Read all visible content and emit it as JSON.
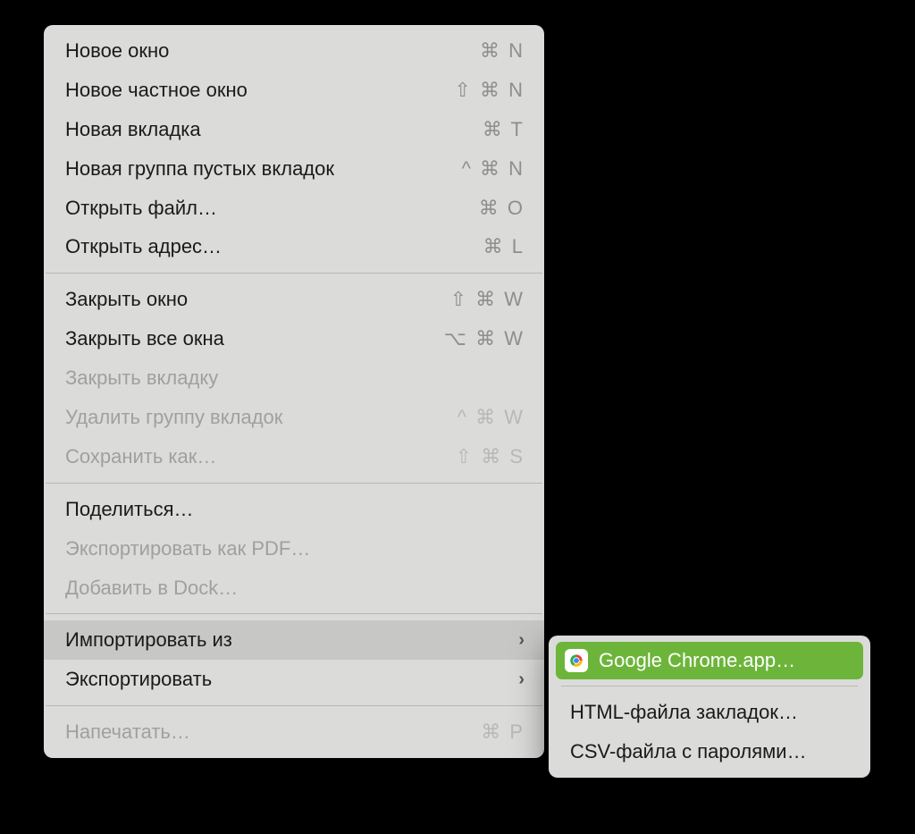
{
  "main_menu": {
    "items": [
      {
        "label": "Новое окно",
        "shortcut": "⌘ N",
        "disabled": false
      },
      {
        "label": "Новое частное окно",
        "shortcut": "⇧ ⌘ N",
        "disabled": false
      },
      {
        "label": "Новая вкладка",
        "shortcut": "⌘ T",
        "disabled": false
      },
      {
        "label": "Новая группа пустых вкладок",
        "shortcut": "^ ⌘ N",
        "disabled": false
      },
      {
        "label": "Открыть файл…",
        "shortcut": "⌘ O",
        "disabled": false
      },
      {
        "label": "Открыть адрес…",
        "shortcut": "⌘ L",
        "disabled": false
      },
      {
        "separator": true
      },
      {
        "label": "Закрыть окно",
        "shortcut": "⇧ ⌘ W",
        "disabled": false
      },
      {
        "label": "Закрыть все окна",
        "shortcut": "⌥ ⌘ W",
        "disabled": false
      },
      {
        "label": "Закрыть вкладку",
        "shortcut": "",
        "disabled": true
      },
      {
        "label": "Удалить группу вкладок",
        "shortcut": "^ ⌘ W",
        "disabled": true
      },
      {
        "label": "Сохранить как…",
        "shortcut": "⇧ ⌘ S",
        "disabled": true
      },
      {
        "separator": true
      },
      {
        "label": "Поделиться…",
        "shortcut": "",
        "disabled": false
      },
      {
        "label": "Экспортировать как PDF…",
        "shortcut": "",
        "disabled": true
      },
      {
        "label": "Добавить в Dock…",
        "shortcut": "",
        "disabled": true
      },
      {
        "separator": true
      },
      {
        "label": "Импортировать из",
        "shortcut": "",
        "disabled": false,
        "submenu": true,
        "highlight": true
      },
      {
        "label": "Экспортировать",
        "shortcut": "",
        "disabled": false,
        "submenu": true
      },
      {
        "separator": true
      },
      {
        "label": "Напечатать…",
        "shortcut": "⌘ P",
        "disabled": true
      }
    ]
  },
  "submenu": {
    "items": [
      {
        "label": "Google Chrome.app…",
        "icon": "chrome",
        "highlight": true
      },
      {
        "separator": true
      },
      {
        "label": "HTML-файла закладок…"
      },
      {
        "label": "CSV-файла с паролями…"
      }
    ]
  }
}
